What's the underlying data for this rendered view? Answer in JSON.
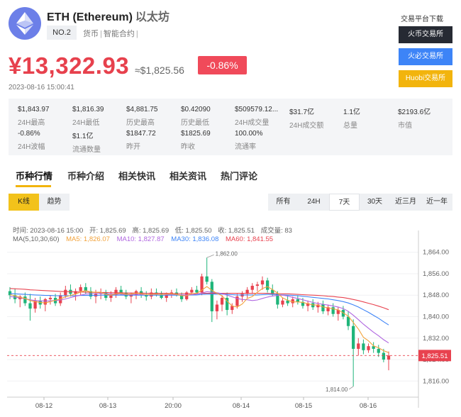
{
  "coin": {
    "name": "ETH (Ethereum)",
    "name_cn": "以太坊",
    "rank": "NO.2",
    "tags": [
      "货币",
      "智能合约"
    ],
    "price_cny": "¥13,322.93",
    "price_usd": "≈$1,825.56",
    "change": "-0.86%",
    "timestamp": "2023-08-16 15:00:41"
  },
  "exchange": {
    "title": "交易平台下载",
    "buttons": [
      "火币交易所",
      "火必交易所",
      "Huobi交易所"
    ]
  },
  "stats": [
    {
      "value": "$1,843.97",
      "label": "24H最高"
    },
    {
      "value": "$1,816.39",
      "label": "24H最低"
    },
    {
      "value": "$4,881.75",
      "label": "历史最高"
    },
    {
      "value": "$0.42090",
      "label": "历史最低"
    },
    {
      "value": "$509579.12...",
      "label": "24H成交量"
    },
    {
      "value": "$31.7亿",
      "label": "24H成交额"
    },
    {
      "value": "1.1亿",
      "label": "总量"
    },
    {
      "value": "$2193.6亿",
      "label": "市值"
    },
    {
      "value": "-0.86%",
      "label": "24H波幅"
    },
    {
      "value": "$1.1亿",
      "label": "流通数量"
    },
    {
      "value": "$1847.72",
      "label": "昨开"
    },
    {
      "value": "$1825.69",
      "label": "昨收"
    },
    {
      "value": "100.00%",
      "label": "流通率"
    }
  ],
  "tabs": [
    "币种行情",
    "币种介绍",
    "相关快讯",
    "相关资讯",
    "热门评论"
  ],
  "chart_type_toggle": [
    "K线",
    "趋势"
  ],
  "ranges": [
    "所有",
    "24H",
    "7天",
    "30天",
    "近三月",
    "近一年"
  ],
  "chart_info": {
    "time": "时间: 2023-08-16 15:00",
    "open": "开: 1,825.69",
    "high": "高: 1,825.69",
    "low": "低: 1,825.50",
    "close": "收: 1,825.51",
    "volume": "成交量: 83",
    "ma_label": "MA(5,10,30,60)",
    "ma5": "MA5: 1,826.07",
    "ma10": "MA10: 1,827.87",
    "ma30": "MA30: 1,836.08",
    "ma60": "MA60: 1,841.55"
  },
  "colors": {
    "up": "#e8424f",
    "down": "#1fb57a",
    "ma5": "#f2a23a",
    "ma10": "#b066e0",
    "ma30": "#3d84f7",
    "ma60": "#e8424f",
    "accent": "#f2b40d"
  },
  "chart_data": {
    "type": "candlestick",
    "ylim": [
      1810,
      1870
    ],
    "y_ticks": [
      "1,864.00",
      "1,856.00",
      "1,848.00",
      "1,840.00",
      "1,832.00",
      "1,824.00",
      "1,816.00"
    ],
    "x_ticks": [
      "08-12",
      "08-13",
      "20:00",
      "08-14",
      "08-15",
      "08-16"
    ],
    "current_price": "1,825.51",
    "high_annotation": "1,862.00",
    "low_annotation": "1,814.00",
    "candles": [
      [
        1849.5,
        1851.0,
        1846.5,
        1848.0
      ],
      [
        1848.0,
        1850.5,
        1845.0,
        1846.5
      ],
      [
        1846.5,
        1848.0,
        1843.5,
        1847.5
      ],
      [
        1847.5,
        1849.0,
        1844.0,
        1845.0
      ],
      [
        1845.0,
        1848.5,
        1838.5,
        1843.0
      ],
      [
        1843.0,
        1847.0,
        1841.5,
        1846.0
      ],
      [
        1846.0,
        1847.5,
        1843.0,
        1844.5
      ],
      [
        1844.5,
        1847.0,
        1842.0,
        1846.5
      ],
      [
        1846.5,
        1848.0,
        1844.5,
        1847.0
      ],
      [
        1847.0,
        1848.5,
        1844.0,
        1845.0
      ],
      [
        1845.0,
        1849.0,
        1844.0,
        1848.0
      ],
      [
        1848.0,
        1851.5,
        1847.0,
        1850.0
      ],
      [
        1850.0,
        1852.0,
        1847.5,
        1848.5
      ],
      [
        1848.5,
        1850.5,
        1846.0,
        1849.5
      ],
      [
        1849.5,
        1852.0,
        1848.0,
        1851.0
      ],
      [
        1851.0,
        1852.5,
        1848.5,
        1849.5
      ],
      [
        1849.5,
        1851.0,
        1846.5,
        1847.5
      ],
      [
        1847.5,
        1850.0,
        1845.0,
        1848.5
      ],
      [
        1848.5,
        1850.5,
        1846.5,
        1849.0
      ],
      [
        1849.0,
        1850.0,
        1846.0,
        1847.0
      ],
      [
        1847.0,
        1849.5,
        1845.5,
        1848.0
      ],
      [
        1848.0,
        1851.0,
        1847.0,
        1850.0
      ],
      [
        1850.0,
        1851.5,
        1848.0,
        1849.0
      ],
      [
        1849.0,
        1850.0,
        1846.5,
        1847.5
      ],
      [
        1847.5,
        1849.0,
        1845.0,
        1848.0
      ],
      [
        1848.0,
        1850.0,
        1846.5,
        1849.5
      ],
      [
        1849.5,
        1851.0,
        1847.0,
        1848.0
      ],
      [
        1848.0,
        1849.5,
        1846.0,
        1847.5
      ],
      [
        1847.5,
        1850.5,
        1846.5,
        1849.0
      ],
      [
        1849.0,
        1850.5,
        1847.5,
        1848.5
      ],
      [
        1848.5,
        1849.5,
        1846.5,
        1847.0
      ],
      [
        1847.0,
        1849.0,
        1845.5,
        1848.5
      ],
      [
        1848.5,
        1850.0,
        1847.0,
        1849.0
      ],
      [
        1849.0,
        1850.5,
        1847.5,
        1848.0
      ],
      [
        1848.0,
        1849.0,
        1845.5,
        1846.5
      ],
      [
        1846.5,
        1849.5,
        1846.0,
        1849.0
      ],
      [
        1849.0,
        1851.0,
        1848.0,
        1850.0
      ],
      [
        1850.0,
        1851.5,
        1848.5,
        1849.0
      ],
      [
        1849.0,
        1856.0,
        1848.0,
        1855.0
      ],
      [
        1855.0,
        1862.0,
        1852.0,
        1853.0
      ],
      [
        1853.0,
        1854.0,
        1838.0,
        1842.0
      ],
      [
        1842.0,
        1846.0,
        1839.0,
        1844.5
      ],
      [
        1844.5,
        1848.0,
        1842.0,
        1847.0
      ],
      [
        1847.0,
        1849.0,
        1840.5,
        1842.5
      ],
      [
        1842.5,
        1845.0,
        1841.0,
        1844.0
      ],
      [
        1844.0,
        1848.5,
        1843.0,
        1847.5
      ],
      [
        1847.5,
        1849.5,
        1845.5,
        1848.5
      ],
      [
        1848.5,
        1851.0,
        1847.0,
        1850.0
      ],
      [
        1850.0,
        1852.5,
        1848.5,
        1851.5
      ],
      [
        1851.5,
        1853.0,
        1849.5,
        1852.0
      ],
      [
        1852.0,
        1855.0,
        1850.0,
        1853.5
      ],
      [
        1853.5,
        1854.5,
        1849.0,
        1850.0
      ],
      [
        1850.0,
        1852.0,
        1847.5,
        1848.5
      ],
      [
        1848.5,
        1849.5,
        1843.0,
        1844.5
      ],
      [
        1844.5,
        1847.0,
        1843.5,
        1846.0
      ],
      [
        1846.0,
        1848.0,
        1844.0,
        1845.0
      ],
      [
        1845.0,
        1847.5,
        1843.5,
        1846.5
      ],
      [
        1846.5,
        1848.0,
        1844.5,
        1845.5
      ],
      [
        1845.5,
        1847.0,
        1843.0,
        1844.0
      ],
      [
        1844.0,
        1846.0,
        1842.0,
        1845.0
      ],
      [
        1845.0,
        1846.5,
        1842.5,
        1843.5
      ],
      [
        1843.5,
        1845.5,
        1841.5,
        1844.5
      ],
      [
        1844.5,
        1846.0,
        1841.0,
        1842.0
      ],
      [
        1842.0,
        1844.5,
        1840.5,
        1843.5
      ],
      [
        1843.5,
        1845.0,
        1840.0,
        1841.0
      ],
      [
        1841.0,
        1843.5,
        1838.5,
        1842.5
      ],
      [
        1842.5,
        1844.0,
        1839.0,
        1840.0
      ],
      [
        1840.0,
        1842.0,
        1835.0,
        1836.5
      ],
      [
        1836.5,
        1839.0,
        1814.0,
        1828.0
      ],
      [
        1828.0,
        1832.0,
        1825.5,
        1830.0
      ],
      [
        1830.0,
        1831.5,
        1826.0,
        1827.5
      ],
      [
        1827.5,
        1830.0,
        1826.5,
        1829.0
      ],
      [
        1829.0,
        1830.5,
        1826.5,
        1828.0
      ],
      [
        1828.0,
        1829.5,
        1825.0,
        1826.5
      ],
      [
        1826.5,
        1828.0,
        1823.0,
        1824.0
      ],
      [
        1824.0,
        1827.0,
        1820.0,
        1825.51
      ]
    ],
    "ma5": [
      1848.2,
      1847.8,
      1847.2,
      1846.8,
      1846.0,
      1845.6,
      1845.3,
      1845.1,
      1845.6,
      1846.1,
      1846.6,
      1847.4,
      1847.9,
      1848.4,
      1849.2,
      1849.7,
      1849.2,
      1849.1,
      1849.1,
      1848.3,
      1848.0,
      1848.5,
      1848.7,
      1848.3,
      1848.4,
      1848.8,
      1848.5,
      1848.2,
      1848.3,
      1848.4,
      1848.2,
      1848.4,
      1848.5,
      1848.3,
      1847.8,
      1847.8,
      1848.6,
      1848.7,
      1849.9,
      1851.2,
      1849.8,
      1848.7,
      1847.8,
      1845.8,
      1844.0,
      1843.6,
      1844.7,
      1846.8,
      1847.5,
      1849.1,
      1850.5,
      1851.2,
      1850.1,
      1848.8,
      1847.0,
      1846.1,
      1845.5,
      1845.5,
      1845.3,
      1844.8,
      1844.4,
      1844.3,
      1843.6,
      1843.3,
      1842.9,
      1842.5,
      1841.4,
      1840.2,
      1837.8,
      1835.4,
      1832.3,
      1831.0,
      1829.1,
      1828.4,
      1827.3,
      1826.6
    ],
    "ma10": [
      1847.5,
      1847.3,
      1847.0,
      1846.7,
      1846.3,
      1846.0,
      1845.9,
      1845.8,
      1845.9,
      1846.0,
      1846.2,
      1846.6,
      1847.1,
      1847.6,
      1848.0,
      1848.4,
      1848.5,
      1848.6,
      1848.7,
      1848.5,
      1848.4,
      1848.4,
      1848.4,
      1848.2,
      1848.2,
      1848.3,
      1848.2,
      1848.2,
      1848.2,
      1848.3,
      1848.2,
      1848.2,
      1848.3,
      1848.2,
      1848.1,
      1848.1,
      1848.2,
      1848.4,
      1848.8,
      1849.3,
      1849.1,
      1848.9,
      1848.6,
      1848.0,
      1847.4,
      1846.8,
      1846.4,
      1846.3,
      1846.0,
      1846.2,
      1846.8,
      1847.3,
      1847.7,
      1847.9,
      1848.0,
      1847.7,
      1847.2,
      1846.8,
      1846.3,
      1845.8,
      1845.3,
      1844.9,
      1844.6,
      1844.3,
      1844.0,
      1843.6,
      1843.0,
      1842.0,
      1840.5,
      1838.9,
      1837.2,
      1835.7,
      1834.2,
      1832.9,
      1831.4,
      1830.2
    ],
    "ma30": [
      1848.6,
      1848.5,
      1848.4,
      1848.3,
      1848.2,
      1848.1,
      1848.0,
      1847.9,
      1847.9,
      1847.8,
      1847.8,
      1847.8,
      1847.8,
      1847.8,
      1847.9,
      1847.9,
      1847.9,
      1847.9,
      1848.0,
      1848.0,
      1848.0,
      1848.0,
      1848.0,
      1848.0,
      1848.0,
      1848.0,
      1848.0,
      1848.0,
      1848.0,
      1848.0,
      1848.0,
      1848.0,
      1848.0,
      1848.0,
      1848.0,
      1848.0,
      1848.1,
      1848.1,
      1848.3,
      1848.4,
      1848.4,
      1848.4,
      1848.4,
      1848.3,
      1848.2,
      1848.1,
      1848.1,
      1848.1,
      1848.1,
      1848.1,
      1848.2,
      1848.3,
      1848.3,
      1848.2,
      1848.1,
      1848.0,
      1847.9,
      1847.8,
      1847.6,
      1847.4,
      1847.2,
      1847.0,
      1846.8,
      1846.6,
      1846.3,
      1846.0,
      1845.6,
      1845.1,
      1844.4,
      1843.6,
      1842.6,
      1841.6,
      1840.5,
      1839.4,
      1838.1,
      1836.9
    ],
    "ma60": [
      1850.5,
      1850.4,
      1850.3,
      1850.2,
      1850.0,
      1849.9,
      1849.8,
      1849.7,
      1849.6,
      1849.5,
      1849.4,
      1849.3,
      1849.3,
      1849.2,
      1849.2,
      1849.1,
      1849.1,
      1849.0,
      1849.0,
      1849.0,
      1848.9,
      1848.9,
      1848.9,
      1848.8,
      1848.8,
      1848.8,
      1848.8,
      1848.7,
      1848.7,
      1848.7,
      1848.7,
      1848.7,
      1848.6,
      1848.6,
      1848.6,
      1848.6,
      1848.6,
      1848.6,
      1848.7,
      1848.7,
      1848.7,
      1848.7,
      1848.7,
      1848.7,
      1848.7,
      1848.7,
      1848.7,
      1848.7,
      1848.7,
      1848.7,
      1848.7,
      1848.7,
      1848.6,
      1848.6,
      1848.5,
      1848.5,
      1848.4,
      1848.3,
      1848.2,
      1848.1,
      1848.0,
      1847.9,
      1847.8,
      1847.6,
      1847.5,
      1847.3,
      1847.1,
      1846.8,
      1846.4,
      1846.0,
      1845.5,
      1845.0,
      1844.5,
      1843.9,
      1843.3,
      1842.6
    ]
  }
}
